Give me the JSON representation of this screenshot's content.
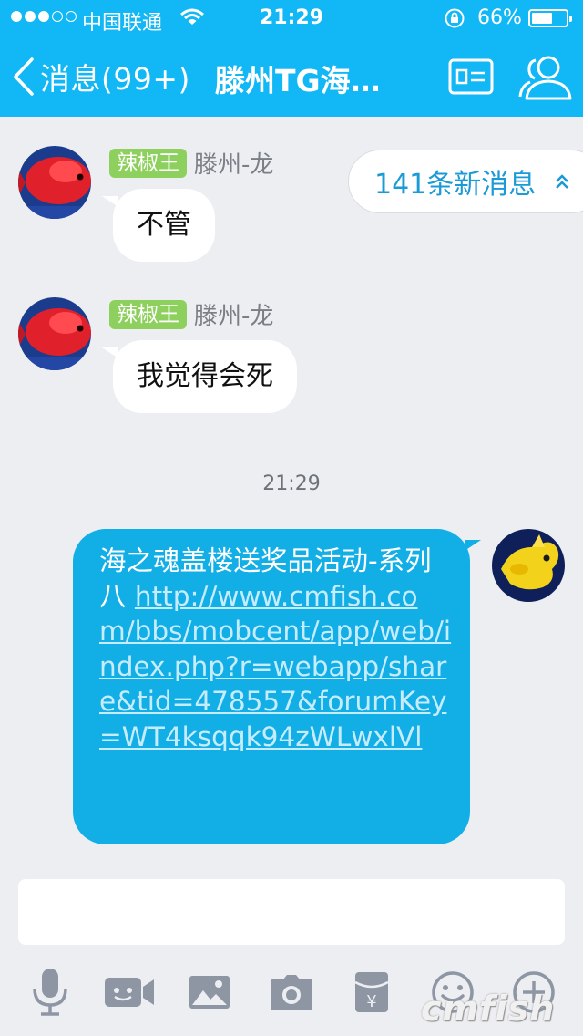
{
  "status_bar": {
    "carrier": "中国联通",
    "time": "21:29",
    "battery": "66%",
    "battery_level": 0.66
  },
  "nav": {
    "back_label": "消息(99+)",
    "title": "滕州TG海…"
  },
  "new_messages_pill": "141条新消息",
  "messages": [
    {
      "level": "辣椒王",
      "sender": "滕州-龙",
      "text": "不管"
    },
    {
      "level": "辣椒王",
      "sender": "滕州-龙",
      "text": "我觉得会死"
    }
  ],
  "timestamp": "21:29",
  "outgoing": {
    "text": "海之魂盖楼送奖品活动-系列八 ",
    "link": "http://www.cmfish.com/bbs/mobcent/app/web/index.php?r=webapp/share&tid=478557&forumKey=WT4ksqqk94zWLwxlVl"
  },
  "input": {
    "value": ""
  },
  "toolbar": [
    "microphone-icon",
    "video-icon",
    "image-icon",
    "camera-icon",
    "red-packet-icon",
    "emoji-icon",
    "plus-icon"
  ],
  "watermark": "cmfish"
}
